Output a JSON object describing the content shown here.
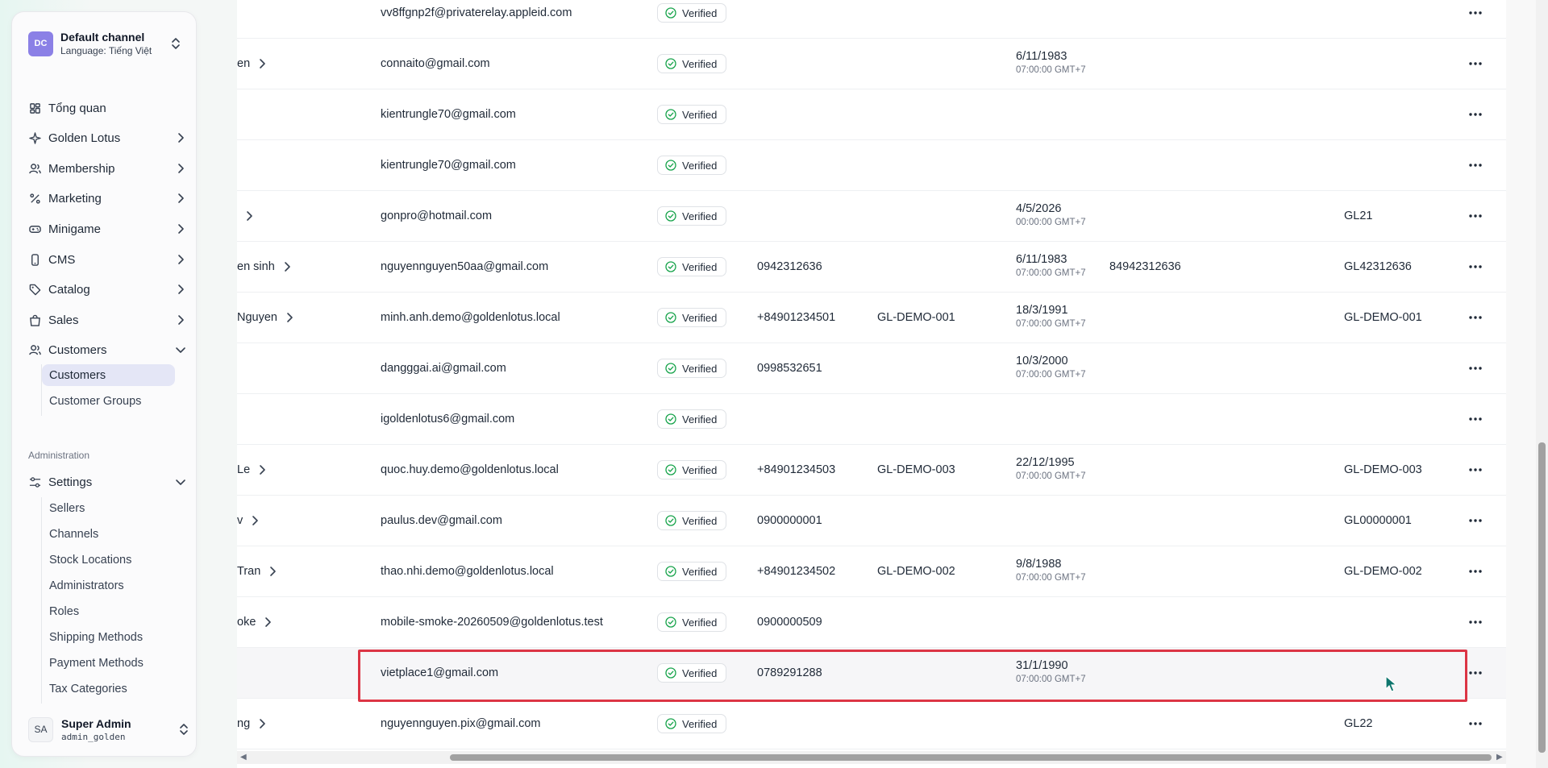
{
  "channel": {
    "initials": "DC",
    "name": "Default channel",
    "language": "Language: Tiếng Việt"
  },
  "nav": {
    "items": [
      {
        "label": "Tổng quan",
        "icon": "dashboard-icon"
      },
      {
        "label": "Golden Lotus",
        "icon": "sparkle-icon"
      },
      {
        "label": "Membership",
        "icon": "users-icon"
      },
      {
        "label": "Marketing",
        "icon": "percent-icon"
      },
      {
        "label": "Minigame",
        "icon": "gamepad-icon"
      },
      {
        "label": "CMS",
        "icon": "phone-icon"
      },
      {
        "label": "Catalog",
        "icon": "tag-icon"
      },
      {
        "label": "Sales",
        "icon": "bag-icon"
      },
      {
        "label": "Customers",
        "icon": "users-icon"
      }
    ],
    "customers_sub": [
      "Customers",
      "Customer Groups"
    ],
    "admin_title": "Administration",
    "settings_label": "Settings",
    "settings_sub": [
      "Sellers",
      "Channels",
      "Stock Locations",
      "Administrators",
      "Roles",
      "Shipping Methods",
      "Payment Methods",
      "Tax Categories"
    ]
  },
  "user": {
    "initials": "SA",
    "name": "Super Admin",
    "handle": "admin_golden"
  },
  "table": {
    "verified_label": "Verified",
    "rows": [
      {
        "name": "",
        "email": "vv8ffgnp2f@privaterelay.appleid.com",
        "phone": "",
        "code": "",
        "dob": "",
        "dob_time": "",
        "zalo": "",
        "member": ""
      },
      {
        "name": "en",
        "email": "connaito@gmail.com",
        "phone": "",
        "code": "",
        "dob": "6/11/1983",
        "dob_time": "07:00:00 GMT+7",
        "zalo": "",
        "member": ""
      },
      {
        "name": "",
        "email": "kientrungle70@gmail.com",
        "phone": "",
        "code": "",
        "dob": "",
        "dob_time": "",
        "zalo": "",
        "member": ""
      },
      {
        "name": "",
        "email": "kientrungle70@gmail.com",
        "phone": "",
        "code": "",
        "dob": "",
        "dob_time": "",
        "zalo": "",
        "member": ""
      },
      {
        "name": "",
        "email": "gonpro@hotmail.com",
        "phone": "",
        "code": "",
        "dob": "4/5/2026",
        "dob_time": "00:00:00 GMT+7",
        "zalo": "",
        "member": "GL21"
      },
      {
        "name": "en sinh",
        "email": "nguyennguyen50aa@gmail.com",
        "phone": "0942312636",
        "code": "",
        "dob": "6/11/1983",
        "dob_time": "07:00:00 GMT+7",
        "zalo": "84942312636",
        "member": "GL42312636"
      },
      {
        "name": "Nguyen",
        "email": "minh.anh.demo@goldenlotus.local",
        "phone": "+84901234501",
        "code": "GL-DEMO-001",
        "dob": "18/3/1991",
        "dob_time": "07:00:00 GMT+7",
        "zalo": "",
        "member": "GL-DEMO-001"
      },
      {
        "name": "",
        "email": "dangggai.ai@gmail.com",
        "phone": "0998532651",
        "code": "",
        "dob": "10/3/2000",
        "dob_time": "07:00:00 GMT+7",
        "zalo": "",
        "member": ""
      },
      {
        "name": "",
        "email": "igoldenlotus6@gmail.com",
        "phone": "",
        "code": "",
        "dob": "",
        "dob_time": "",
        "zalo": "",
        "member": ""
      },
      {
        "name": "Le",
        "email": "quoc.huy.demo@goldenlotus.local",
        "phone": "+84901234503",
        "code": "GL-DEMO-003",
        "dob": "22/12/1995",
        "dob_time": "07:00:00 GMT+7",
        "zalo": "",
        "member": "GL-DEMO-003"
      },
      {
        "name": "v",
        "email": "paulus.dev@gmail.com",
        "phone": "0900000001",
        "code": "",
        "dob": "",
        "dob_time": "",
        "zalo": "",
        "member": "GL00000001"
      },
      {
        "name": "Tran",
        "email": "thao.nhi.demo@goldenlotus.local",
        "phone": "+84901234502",
        "code": "GL-DEMO-002",
        "dob": "9/8/1988",
        "dob_time": "07:00:00 GMT+7",
        "zalo": "",
        "member": "GL-DEMO-002"
      },
      {
        "name": "oke",
        "email": "mobile-smoke-20260509@goldenlotus.test",
        "phone": "0900000509",
        "code": "",
        "dob": "",
        "dob_time": "",
        "zalo": "",
        "member": ""
      },
      {
        "name": "",
        "email": "vietplace1@gmail.com",
        "phone": "0789291288",
        "code": "",
        "dob": "31/1/1990",
        "dob_time": "07:00:00 GMT+7",
        "zalo": "",
        "member": ""
      },
      {
        "name": "ng",
        "email": "nguyennguyen.pix@gmail.com",
        "phone": "",
        "code": "",
        "dob": "",
        "dob_time": "",
        "zalo": "",
        "member": "GL22"
      }
    ]
  },
  "colors": {
    "accent": "#8b80e6",
    "verified": "#16a34a",
    "highlight": "#dc3545"
  }
}
